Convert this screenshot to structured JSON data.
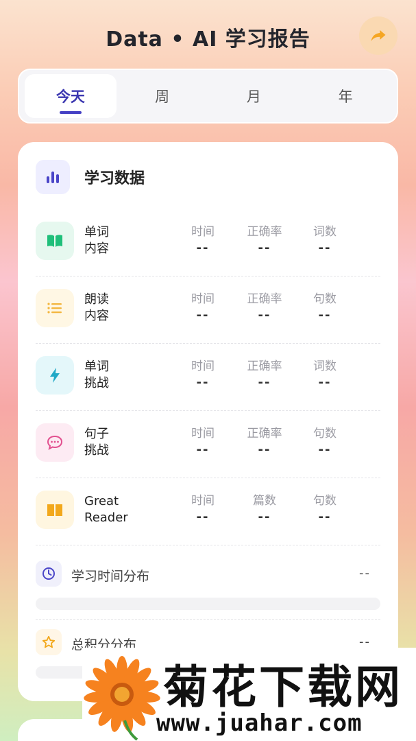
{
  "header": {
    "title": "Data • AI 学习报告"
  },
  "tabs": [
    {
      "label": "今天",
      "active": true
    },
    {
      "label": "周",
      "active": false
    },
    {
      "label": "月",
      "active": false
    },
    {
      "label": "年",
      "active": false
    }
  ],
  "study": {
    "title": "学习数据",
    "rows": [
      {
        "line1": "单词",
        "line2": "内容",
        "m1_label": "时间",
        "m1_value": "--",
        "m2_label": "正确率",
        "m2_value": "--",
        "m3_label": "词数",
        "m3_value": "--",
        "icon": "book-open-icon",
        "color": "#1fbf7a"
      },
      {
        "line1": "朗读",
        "line2": "内容",
        "m1_label": "时间",
        "m1_value": "--",
        "m2_label": "正确率",
        "m2_value": "--",
        "m3_label": "句数",
        "m3_value": "--",
        "icon": "list-icon",
        "color": "#f3b53c"
      },
      {
        "line1": "单词",
        "line2": "挑战",
        "m1_label": "时间",
        "m1_value": "--",
        "m2_label": "正确率",
        "m2_value": "--",
        "m3_label": "词数",
        "m3_value": "--",
        "icon": "lightning-icon",
        "color": "#1fa8c6"
      },
      {
        "line1": "句子",
        "line2": "挑战",
        "m1_label": "时间",
        "m1_value": "--",
        "m2_label": "正确率",
        "m2_value": "--",
        "m3_label": "句数",
        "m3_value": "--",
        "icon": "chat-bubble-icon",
        "color": "#e2508f"
      },
      {
        "line1": "Great",
        "line2": "Reader",
        "m1_label": "时间",
        "m1_value": "--",
        "m2_label": "篇数",
        "m2_value": "--",
        "m3_label": "句数",
        "m3_value": "--",
        "icon": "book-icon",
        "color": "#f2a81c"
      }
    ],
    "time_dist": {
      "label": "学习时间分布",
      "value": "--",
      "icon": "clock-icon"
    },
    "score_dist": {
      "label": "总积分分布",
      "value": "--",
      "icon": "star-icon"
    }
  },
  "watermark": {
    "text": "菊花下载网",
    "url": "www.juahar.com"
  },
  "colors": {
    "accent": "#4540c4",
    "share": "#f5a623"
  }
}
